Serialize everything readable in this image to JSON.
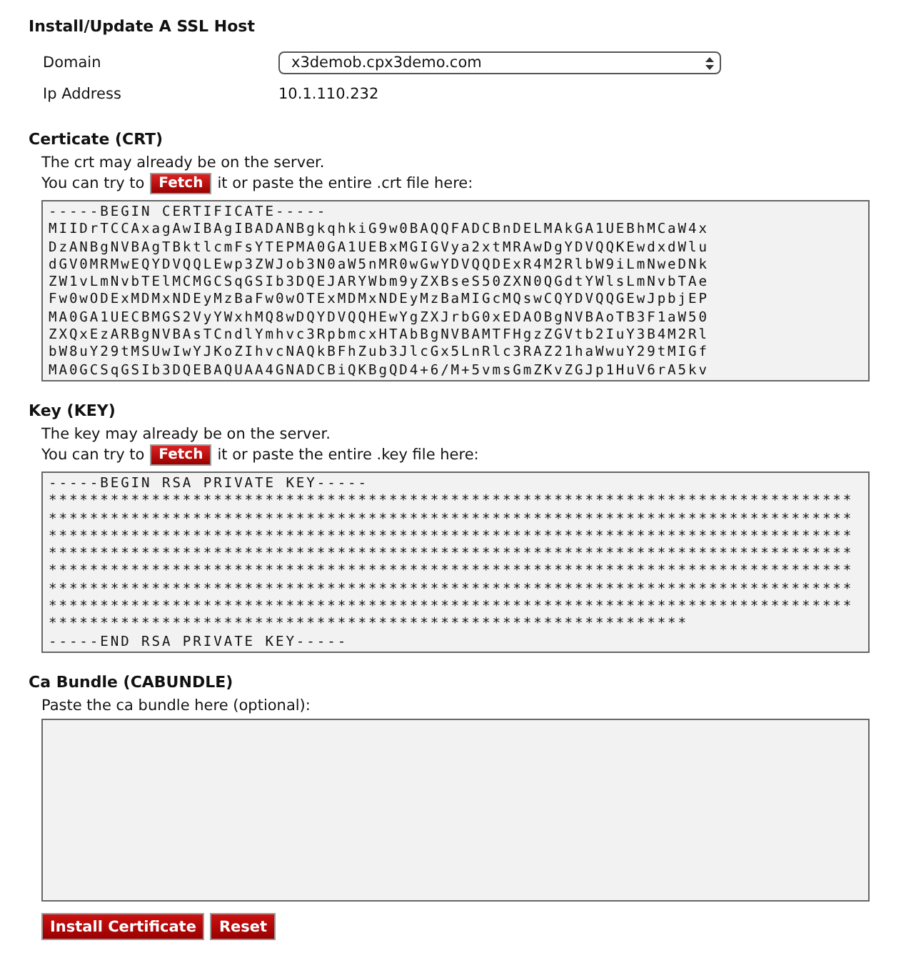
{
  "title": "Install/Update A SSL Host",
  "fields": [
    {
      "label": "Domain",
      "kind": "select",
      "value": "x3demob.cpx3demo.com"
    },
    {
      "label": "Ip Address",
      "kind": "text",
      "value": "10.1.110.232"
    }
  ],
  "sections": [
    {
      "heading": "Certicate (CRT)",
      "note": "The crt may already be on the server.",
      "fetch_before": "You can try to",
      "fetch_button": "Fetch",
      "fetch_after": "it or paste the entire .crt file here:",
      "lines": [
        "-----BEGIN CERTIFICATE-----",
        "MIIDrTCCAxagAwIBAgIBADANBgkqhkiG9w0BAQQFADCBnDELMAkGA1UEBhMCaW4x",
        "DzANBgNVBAgTBktlcmFsYTEPMA0GA1UEBxMGIGVya2xtMRAwDgYDVQQKEwdxdWlu",
        "dGV0MRMwEQYDVQQLEwp3ZWJob3N0aW5nMR0wGwYDVQQDExR4M2RlbW9iLmNweDNk",
        "ZW1vLmNvbTElMCMGCSqGSIb3DQEJARYWbm9yZXBseS50ZXN0QGdtYWlsLmNvbTAe",
        "Fw0wODExMDMxNDEyMzBaFw0wOTExMDMxNDEyMzBaMIGcMQswCQYDVQQGEwJpbjEP",
        "MA0GA1UECBMGS2VyYWxhMQ8wDQYDVQQHEwYgZXJrbG0xEDAOBgNVBAoTB3F1aW50",
        "ZXQxEzARBgNVBAsTCndlYmhvc3RpbmcxHTAbBgNVBAMTFHgzZGVtb2IuY3B4M2Rl",
        "bW8uY29tMSUwIwYJKoZIhvcNAQkBFhZub3JlcGx5LnRlc3RAZ21haWwuY29tMIGf",
        "MA0GCSqGSIb3DQEBAQUAA4GNADCBiQKBgQD4+6/M+5vmsGmZKvZGJp1HuV6rA5kv"
      ]
    },
    {
      "heading": "Key (KEY)",
      "note": "The key may already be on the server.",
      "fetch_before": "You can try to",
      "fetch_button": "Fetch",
      "fetch_after": "it or paste the entire .key file here:",
      "lines": [
        "-----BEGIN RSA PRIVATE KEY-----",
        "******************************************************************************",
        "******************************************************************************",
        "******************************************************************************",
        "******************************************************************************",
        "******************************************************************************",
        "******************************************************************************",
        "******************************************************************************",
        "**************************************************************",
        "-----END RSA PRIVATE KEY-----"
      ]
    },
    {
      "heading": "Ca Bundle (CABUNDLE)",
      "note": "Paste the ca bundle here (optional):"
    }
  ],
  "buttons": [
    "Install Certificate",
    "Reset"
  ]
}
